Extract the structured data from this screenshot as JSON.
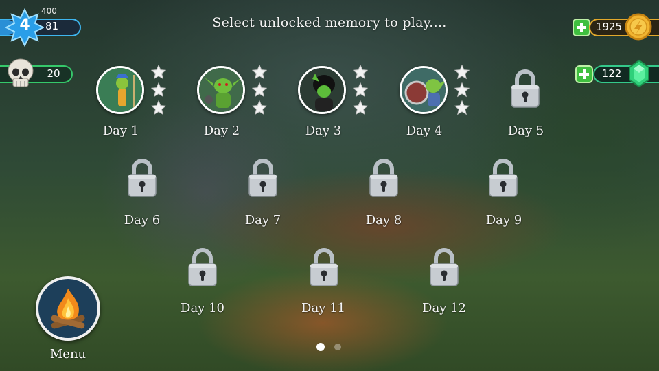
{
  "header": {
    "title": "Select unlocked memory to play...."
  },
  "player": {
    "level": "4",
    "xp_current": "81",
    "xp_max": "400",
    "xp_fraction": 0.2025,
    "skulls": "20"
  },
  "currency": {
    "coins": "1925",
    "gems": "122"
  },
  "memories": [
    {
      "label": "Day 1",
      "unlocked": true,
      "stars_earned": 0,
      "stars_total": 3,
      "portrait": "archer-goblin-portrait"
    },
    {
      "label": "Day 2",
      "unlocked": true,
      "stars_earned": 0,
      "stars_total": 3,
      "portrait": "goblin-warrior-portrait"
    },
    {
      "label": "Day 3",
      "unlocked": true,
      "stars_earned": 0,
      "stars_total": 3,
      "portrait": "dark-goblin-portrait"
    },
    {
      "label": "Day 4",
      "unlocked": true,
      "stars_earned": 0,
      "stars_total": 3,
      "portrait": "goblin-shield-portrait"
    },
    {
      "label": "Day 5",
      "unlocked": false
    },
    {
      "label": "Day 6",
      "unlocked": false
    },
    {
      "label": "Day 7",
      "unlocked": false
    },
    {
      "label": "Day 8",
      "unlocked": false
    },
    {
      "label": "Day 9",
      "unlocked": false
    },
    {
      "label": "Day 10",
      "unlocked": false
    },
    {
      "label": "Day 11",
      "unlocked": false
    },
    {
      "label": "Day 12",
      "unlocked": false
    }
  ],
  "menu": {
    "label": "Menu",
    "icon": "campfire-icon"
  },
  "pagination": {
    "pages": 2,
    "current": 1
  },
  "colors": {
    "xp_accent": "#3fb6f0",
    "skull_accent": "#35c86a",
    "coin_accent": "#e3a92c",
    "gem_accent": "#34c98a",
    "plus_button": "#3fbf3f"
  }
}
